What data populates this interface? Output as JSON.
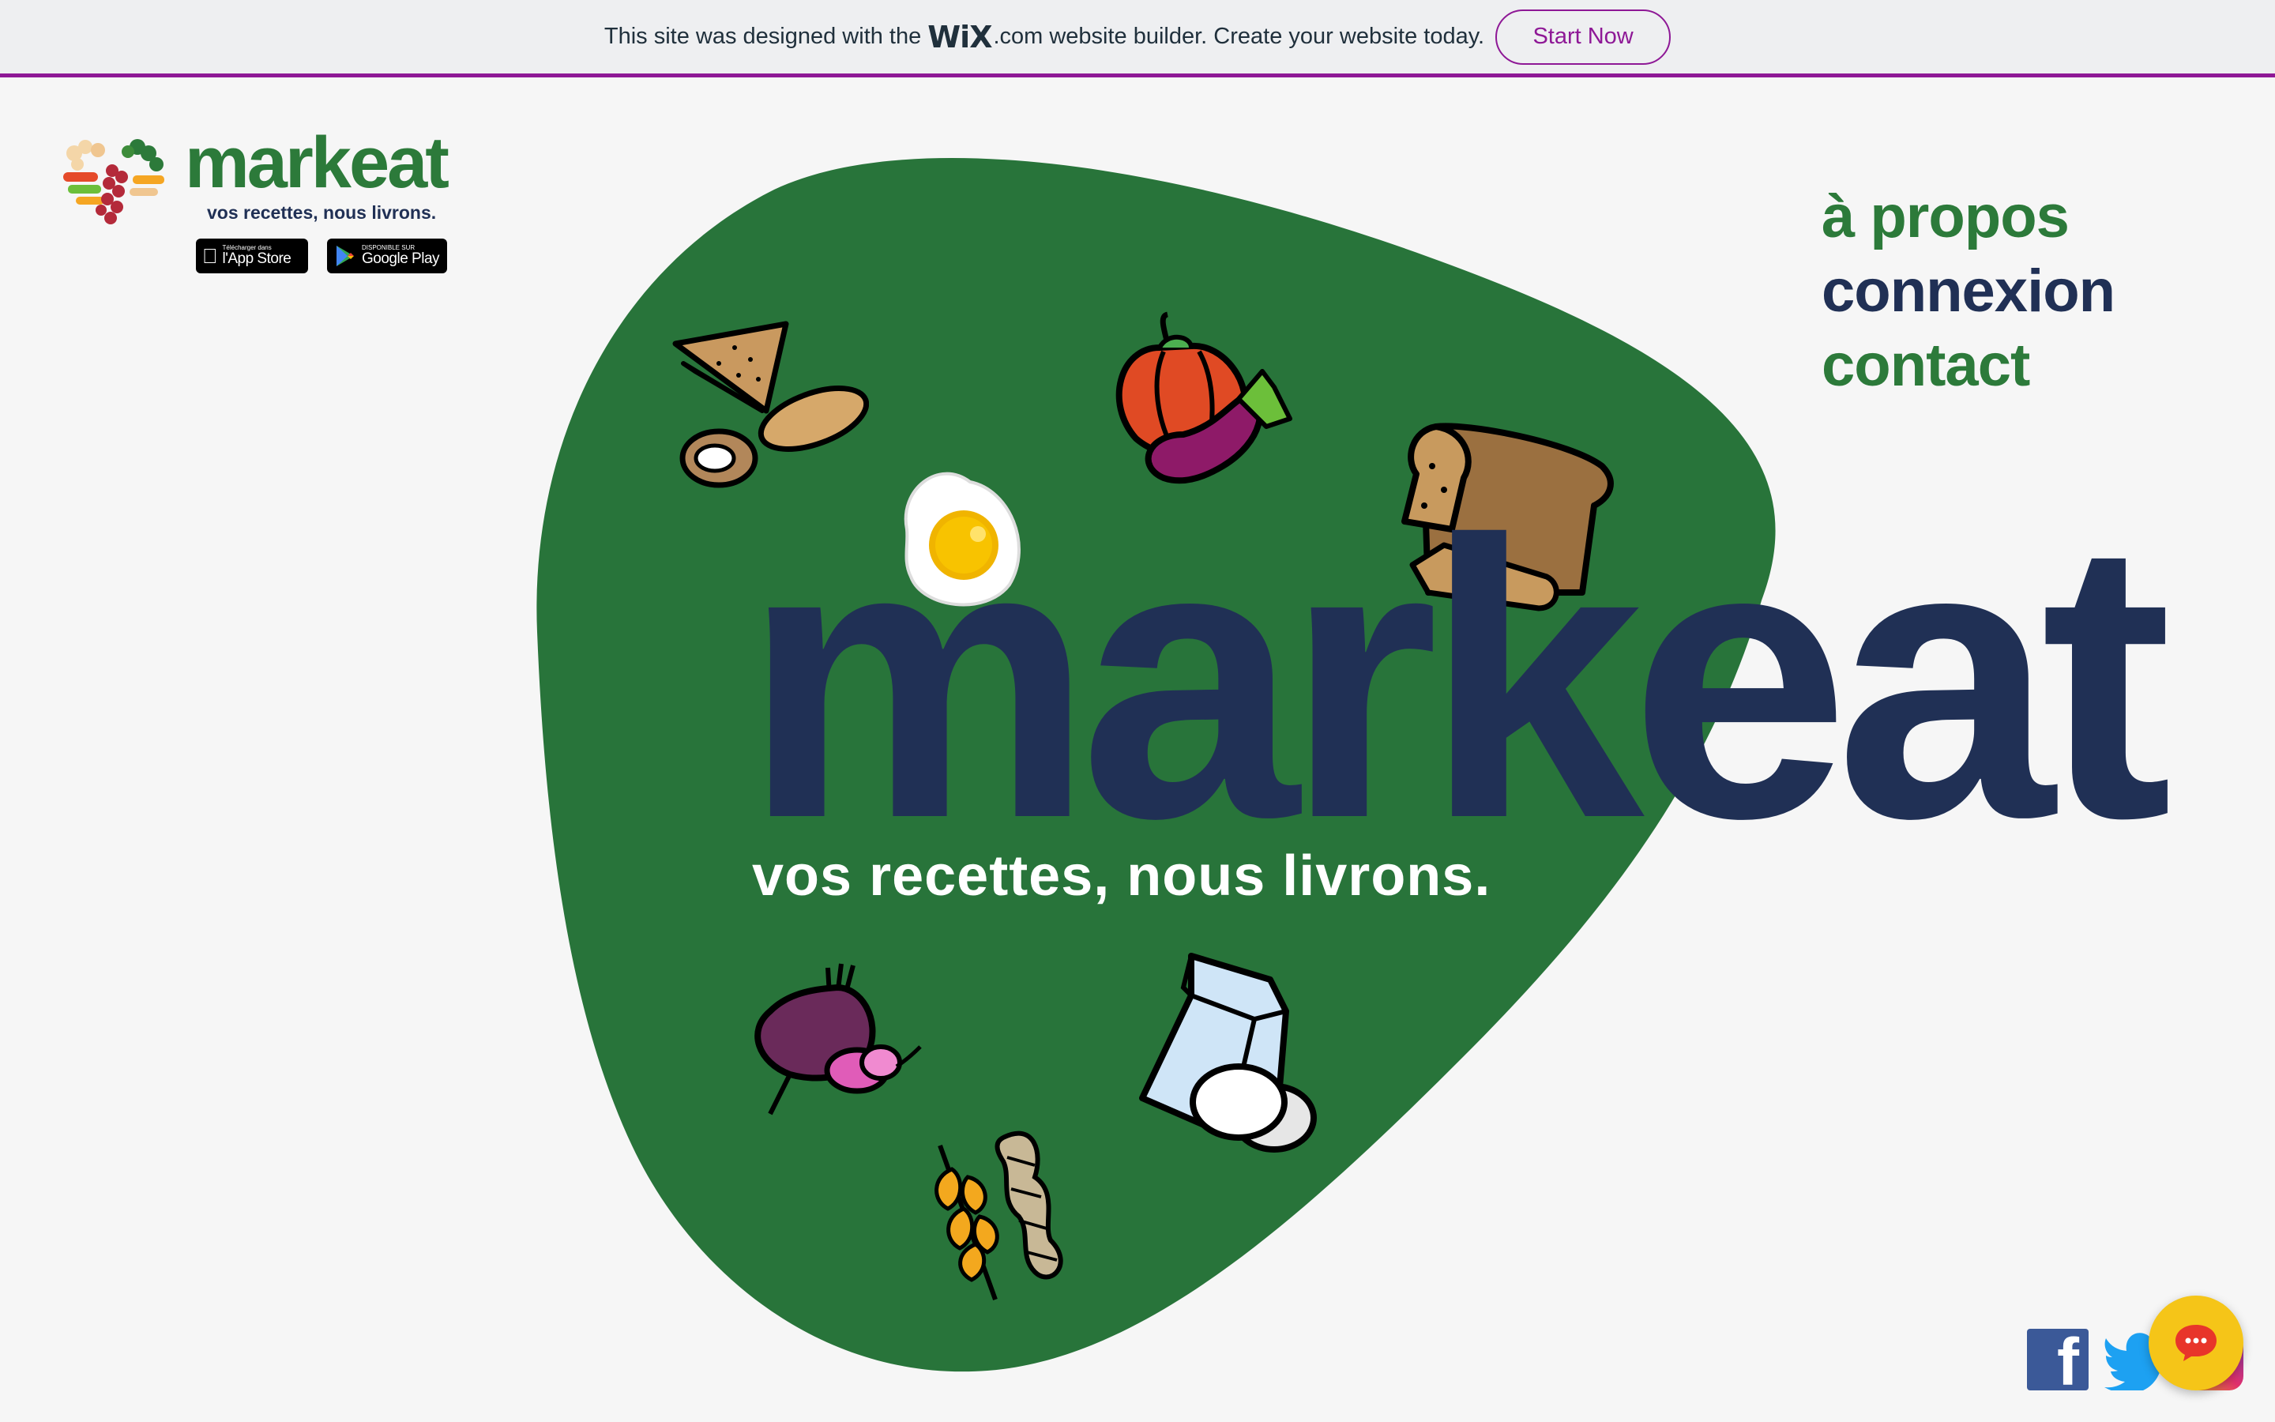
{
  "wix_banner": {
    "text_before": "This site was designed with the",
    "wix_logo": "WiX",
    "text_dotcom": ".com",
    "text_after": "website builder. Create your website today.",
    "cta_label": "Start Now"
  },
  "logo": {
    "word": "markeat",
    "tagline": "vos recettes, nous livrons.",
    "app_store": {
      "small": "Télécharger dans",
      "big": "l'App Store"
    },
    "google_play": {
      "small": "DISPONIBLE SUR",
      "big": "Google Play"
    }
  },
  "nav": {
    "items": [
      "à propos",
      "connexion",
      "contact"
    ]
  },
  "hero": {
    "title": "markeat",
    "tagline": "vos recettes, nous livrons."
  },
  "social": [
    "facebook-icon",
    "twitter-icon",
    "instagram-icon"
  ],
  "colors": {
    "brand_green": "#2c7a3a",
    "navy": "#203055",
    "wix_purple": "#8e1896",
    "chat_yellow": "#f5c518"
  }
}
